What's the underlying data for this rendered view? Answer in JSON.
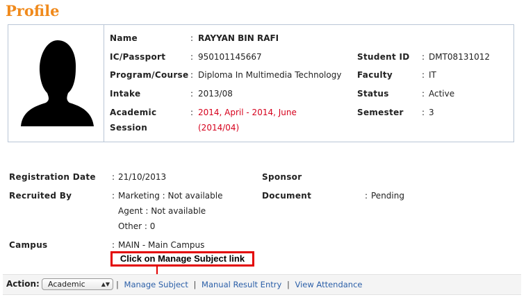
{
  "page_title": "Profile",
  "profile": {
    "name_label": "Name",
    "name_value": "RAYYAN BIN RAFI",
    "ic_label": "IC/Passport",
    "ic_value": "950101145667",
    "student_id_label": "Student ID",
    "student_id_value": "DMT08131012",
    "program_label": "Program/Course",
    "program_value": "Diploma In Multimedia Technology",
    "faculty_label": "Faculty",
    "faculty_value": "IT",
    "intake_label": "Intake",
    "intake_value": "2013/08",
    "status_label": "Status",
    "status_value": "Active",
    "session_label_1": "Academic",
    "session_label_2": "Session",
    "session_value_1": "2014, April - 2014, June",
    "session_value_2": "(2014/04)",
    "semester_label": "Semester",
    "semester_value": "3",
    "separator": ":"
  },
  "details": {
    "reg_date_label": "Registration Date",
    "reg_date_value": "21/10/2013",
    "sponsor_label": "Sponsor",
    "recruited_label": "Recruited By",
    "recruited_marketing": "Marketing : Not available",
    "recruited_agent": "Agent : Not available",
    "recruited_other": "Other : 0",
    "document_label": "Document",
    "document_value": "Pending",
    "campus_label": "Campus",
    "campus_value": "MAIN - Main Campus"
  },
  "callout_text": "Click on Manage Subject link",
  "action": {
    "label": "Action:",
    "select_value": "Academic",
    "links": [
      "Manage Subject",
      "Manual Result Entry",
      "View Attendance"
    ],
    "link_separator": "|"
  },
  "colors": {
    "title": "#f08a1c",
    "highlight_red": "#d6001c",
    "callout_border": "#e30000",
    "link": "#2b5fa8"
  },
  "icons": {
    "avatar": "person-silhouette-icon",
    "select": "chevron-updown-icon"
  }
}
